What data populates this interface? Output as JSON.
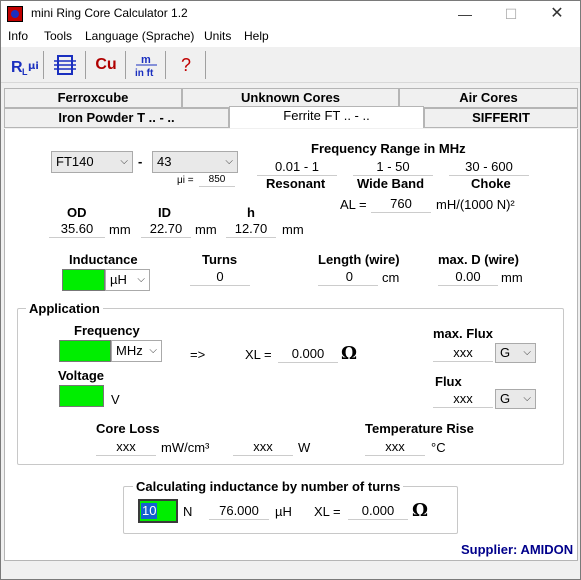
{
  "window": {
    "title": "mini Ring Core Calculator 1.2",
    "minimize": "—",
    "maximize": "☐",
    "close": "✕"
  },
  "menu": [
    "Info",
    "Tools",
    "Language (Sprache)",
    "Units",
    "Help"
  ],
  "toolbar": {
    "btn_al": "AL/μi",
    "btn_core": "core",
    "btn_cu": "Cu",
    "btn_unit": "m in ft",
    "btn_help": "?"
  },
  "tabs": {
    "row1": [
      "Ferroxcube",
      "Unknown Cores",
      "Air Cores"
    ],
    "row2": [
      "Iron Powder T .. - ..",
      "Ferrite FT .. - ..",
      "SIFFERIT"
    ]
  },
  "core": {
    "type": "FT140",
    "dash": "-",
    "material": "43",
    "mu_label": "μi =",
    "mu_value": "850"
  },
  "freq_range": {
    "title": "Frequency Range in MHz",
    "resonant_value": "0.01 - 1",
    "resonant_label": "Resonant",
    "wideband_value": "1 - 50",
    "wideband_label": "Wide Band",
    "choke_value": "30 - 600",
    "choke_label": "Choke"
  },
  "al": {
    "label": "AL =",
    "value": "760",
    "unit": "mH/(1000 N)²"
  },
  "dims": {
    "od_label": "OD",
    "od_value": "35.60",
    "od_unit": "mm",
    "id_label": "ID",
    "id_value": "22.70",
    "id_unit": "mm",
    "h_label": "h",
    "h_value": "12.70",
    "h_unit": "mm"
  },
  "inductance": {
    "label": "Inductance",
    "unit": "µH"
  },
  "turns": {
    "label": "Turns",
    "value": "0"
  },
  "length": {
    "label": "Length (wire)",
    "value": "0",
    "unit": "cm"
  },
  "maxd": {
    "label": "max. D (wire)",
    "value": "0.00",
    "unit": "mm"
  },
  "application": {
    "title": "Application",
    "frequency_label": "Frequency",
    "frequency_unit": "MHz",
    "arrow": "=>",
    "xl_label": "XL =",
    "xl_value": "0.000",
    "omega": "Ω",
    "voltage_label": "Voltage",
    "voltage_unit": "V",
    "maxflux_label": "max. Flux",
    "maxflux_value": "xxx",
    "maxflux_unit": "G",
    "flux_label": "Flux",
    "flux_value": "xxx",
    "flux_unit": "G",
    "coreloss_label": "Core Loss",
    "coreloss_value": "xxx",
    "coreloss_unit": "mW/cm³",
    "w_value": "xxx",
    "w_unit": "W",
    "temp_label": "Temperature Rise",
    "temp_value": "xxx",
    "temp_unit": "°C"
  },
  "calc": {
    "title": "Calculating inductance by number of turns",
    "turns_value": "10",
    "turns_unit": "N",
    "l_value": "76.000",
    "l_unit": "µH",
    "xl_label": "XL =",
    "xl_value": "0.000",
    "omega": "Ω"
  },
  "supplier": "Supplier: AMIDON"
}
